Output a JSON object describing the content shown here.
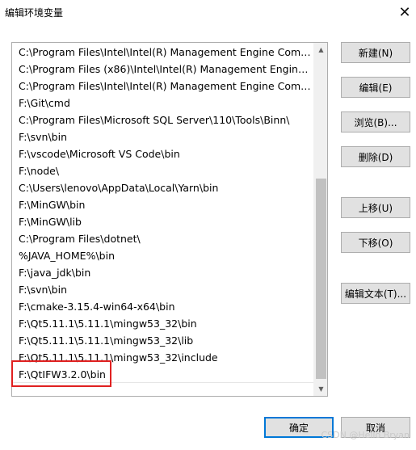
{
  "window": {
    "title": "编辑环境变量",
    "close_glyph": "✕"
  },
  "paths": [
    "C:\\Program Files\\Intel\\Intel(R) Management Engine Compon...",
    "C:\\Program Files (x86)\\Intel\\Intel(R) Management Engine Co...",
    "C:\\Program Files\\Intel\\Intel(R) Management Engine Compon...",
    "F:\\Git\\cmd",
    "C:\\Program Files\\Microsoft SQL Server\\110\\Tools\\Binn\\",
    "F:\\svn\\bin",
    "F:\\vscode\\Microsoft VS Code\\bin",
    "F:\\node\\",
    "C:\\Users\\lenovo\\AppData\\Local\\Yarn\\bin",
    "F:\\MinGW\\bin",
    "F:\\MinGW\\lib",
    "C:\\Program Files\\dotnet\\",
    "%JAVA_HOME%\\bin",
    "F:\\java_jdk\\bin",
    "F:\\svn\\bin",
    "F:\\cmake-3.15.4-win64-x64\\bin",
    "F:\\Qt5.11.1\\5.11.1\\mingw53_32\\bin",
    "F:\\Qt5.11.1\\5.11.1\\mingw53_32\\lib",
    "F:\\Qt5.11.1\\5.11.1\\mingw53_32\\include",
    "F:\\QtIFW3.2.0\\bin"
  ],
  "scrollbar": {
    "up_glyph": "▲",
    "down_glyph": "▼"
  },
  "buttons": {
    "new": "新建(N)",
    "edit": "编辑(E)",
    "browse": "浏览(B)...",
    "delete": "删除(D)",
    "move_up": "上移(U)",
    "move_down": "下移(O)",
    "edit_text": "编辑文本(T)...",
    "ok": "确定",
    "cancel": "取消"
  },
  "colors": {
    "highlight": "#e02020",
    "primary_border": "#0078d7"
  },
  "watermark": "CSDN @Hello Bryan"
}
